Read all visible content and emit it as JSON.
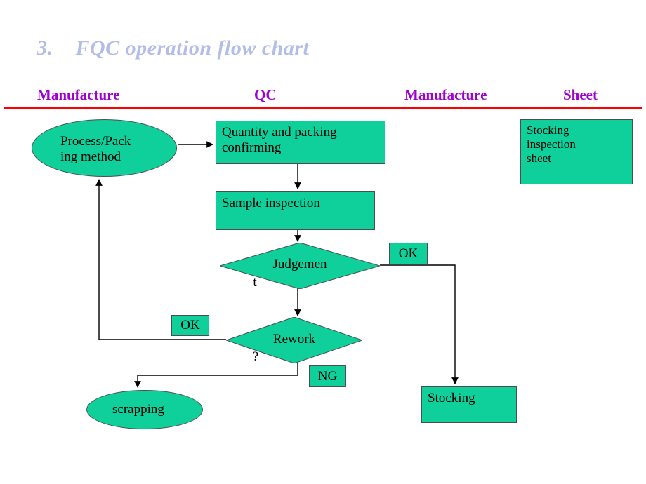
{
  "slide": {
    "title": "3.    FQC operation flow chart",
    "title_color": "#b3bde8",
    "header_rule_color": "#ff0000",
    "background": "#ffffff"
  },
  "columns": [
    {
      "label": "Manufacture"
    },
    {
      "label": "QC"
    },
    {
      "label": "Manufacture"
    },
    {
      "label": "Sheet"
    }
  ],
  "column_header_color": "#a200d2",
  "flowchart": {
    "shape_fill": "#0fcf9a",
    "shape_border": "#4d4d4d",
    "nodes": {
      "process": {
        "text": "Process/Pack\ning method",
        "type": "ellipse",
        "column": "Manufacture"
      },
      "quantity": {
        "text": "Quantity and packing\nconfirming",
        "type": "process",
        "column": "QC"
      },
      "sample": {
        "text": "Sample inspection",
        "type": "process",
        "column": "QC"
      },
      "judgement": {
        "text": "Judgement",
        "line1": "Judgemen",
        "line2": "t",
        "type": "decision",
        "column": "QC"
      },
      "rework": {
        "text": "Rework?",
        "line1": "Rework",
        "line2": "?",
        "type": "decision",
        "column": "QC"
      },
      "scrapping": {
        "text": "scrapping",
        "type": "ellipse",
        "column": "Manufacture"
      },
      "stocking": {
        "text": "Stocking",
        "type": "process",
        "column": "Manufacture"
      },
      "sheet": {
        "text": "Stocking\ninspection\nsheet",
        "type": "document",
        "column": "Sheet"
      }
    },
    "edge_labels": {
      "judgement_ok": "OK",
      "rework_ok": "OK",
      "rework_ng": "NG"
    },
    "edges": [
      {
        "from": "process",
        "to": "quantity",
        "label": ""
      },
      {
        "from": "quantity",
        "to": "sample",
        "label": ""
      },
      {
        "from": "sample",
        "to": "judgement",
        "label": ""
      },
      {
        "from": "judgement",
        "to": "stocking",
        "label": "OK"
      },
      {
        "from": "judgement",
        "to": "rework",
        "label": ""
      },
      {
        "from": "rework",
        "to": "process",
        "label": "OK"
      },
      {
        "from": "rework",
        "to": "scrapping",
        "label": "NG"
      }
    ]
  }
}
